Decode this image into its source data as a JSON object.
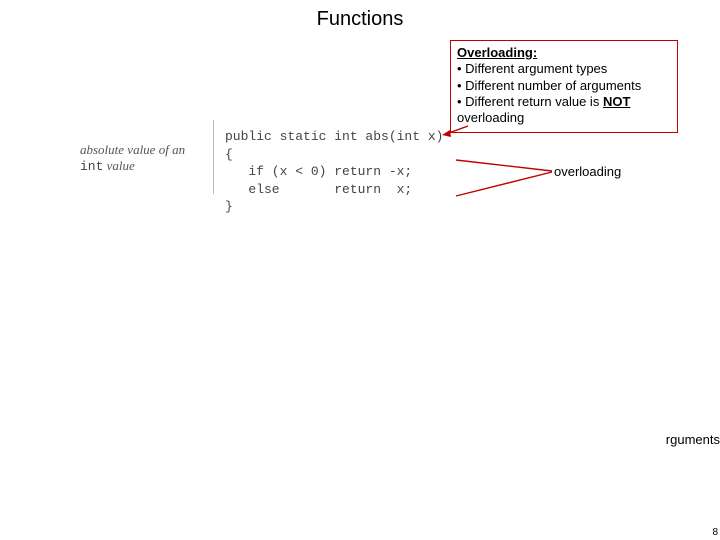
{
  "title": "Functions",
  "label": {
    "line1": "absolute value of an",
    "line2_kw": "int",
    "line2_rest": " value"
  },
  "code": {
    "l1": "public static int abs(int x)",
    "l2": "{",
    "l3": "   if (x < 0) return -x;",
    "l4": "   else       return  x;",
    "l5": "}"
  },
  "callout": {
    "title": "Overloading:",
    "b1": "• Different argument types",
    "b2": "• Different number of arguments",
    "b3_a": "• Different return value is ",
    "b3_not": "NOT",
    "b4": "overloading"
  },
  "overloading_label": "overloading",
  "fragment": "rguments",
  "page": "8"
}
